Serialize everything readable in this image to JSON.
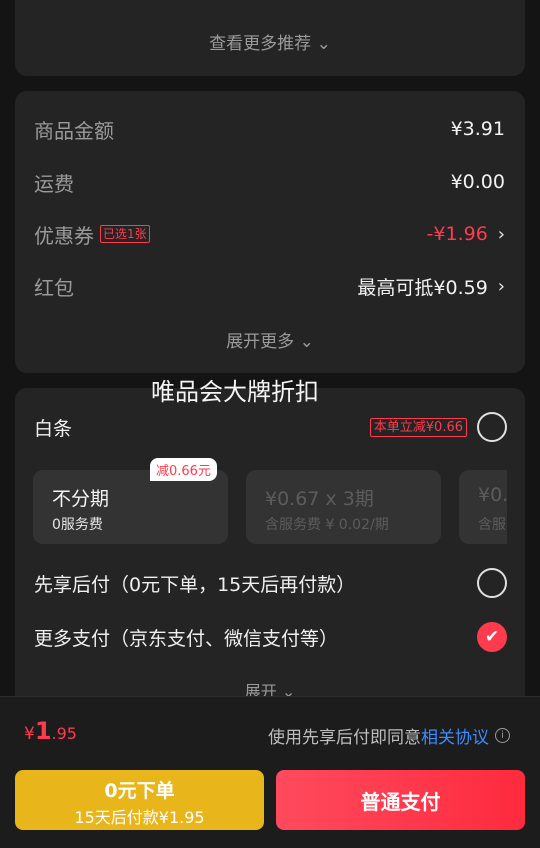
{
  "recommend": {
    "more_label": "查看更多推荐 ⌄"
  },
  "summary": {
    "goods_amount_label": "商品金额",
    "goods_amount_value": "¥3.91",
    "shipping_label": "运费",
    "shipping_value": "¥0.00",
    "coupon_label": "优惠券",
    "coupon_tag": "已选1张",
    "coupon_value": "-¥1.96",
    "redpacket_label": "红包",
    "redpacket_value": "最高可抵¥0.59",
    "expand_label": "展开更多 ⌄"
  },
  "overlay_text": "唯品会大牌折扣",
  "payment": {
    "baitiao_label": "白条",
    "baitiao_promo": "本单立减¥0.66",
    "save_badge": "减0.66元",
    "plans": [
      {
        "title": "不分期",
        "sub": "0服务费"
      },
      {
        "title": "¥0.67 x 3期",
        "sub": "含服务费 ¥ 0.02/期"
      },
      {
        "title": "¥0.",
        "sub": "含服"
      }
    ],
    "later_label": "先享后付（0元下单，15天后再付款）",
    "more_label": "更多支付（京东支付、微信支付等）",
    "expand_label": "展开 ⌄"
  },
  "bottom": {
    "total_symbol": "¥",
    "total_int": "1",
    "total_dec": ".95",
    "agree_text": "使用先享后付即同意",
    "agree_link": "相关协议",
    "later_btn_line1": "0元下单",
    "later_btn_line2": "15天后付款¥1.95",
    "pay_btn": "普通支付"
  },
  "colors": {
    "accent_red": "#ff3b4e",
    "yellow": "#e8b51a",
    "link_blue": "#3d8bff"
  }
}
